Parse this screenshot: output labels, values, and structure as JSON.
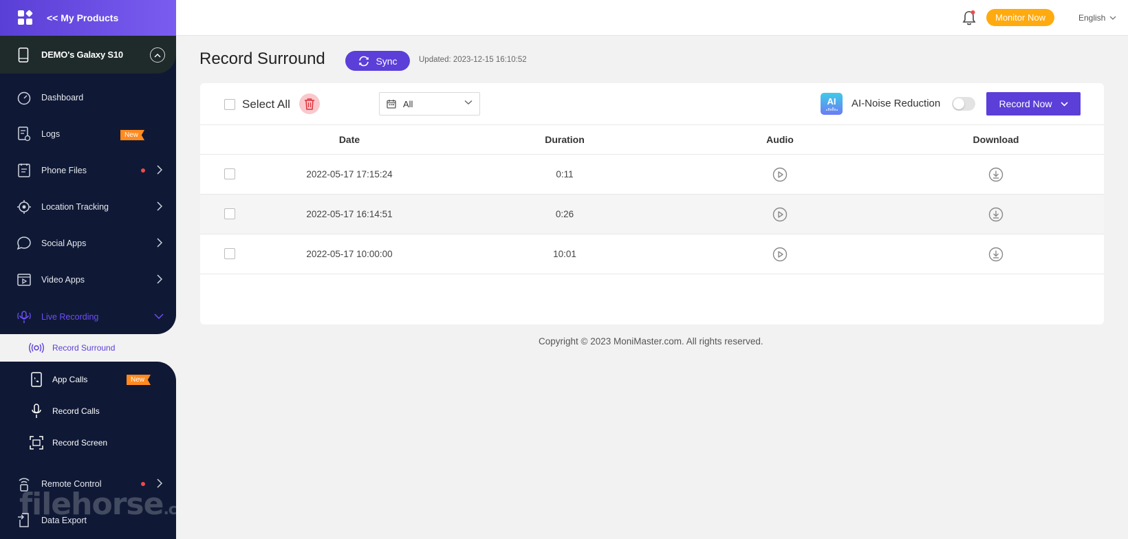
{
  "sidebar": {
    "products_label": "<< My Products",
    "device_name": "DEMO's Galaxy S10",
    "items": [
      {
        "label": "Dashboard"
      },
      {
        "label": "Logs",
        "badge": "New"
      },
      {
        "label": "Phone Files"
      },
      {
        "label": "Location Tracking"
      },
      {
        "label": "Social Apps"
      },
      {
        "label": "Video Apps"
      },
      {
        "label": "Live Recording"
      },
      {
        "label": "Remote Control"
      },
      {
        "label": "Data Export"
      }
    ],
    "sub_items": [
      {
        "label": "Record Surround"
      },
      {
        "label": "App Calls",
        "badge": "New"
      },
      {
        "label": "Record Calls"
      },
      {
        "label": "Record Screen"
      }
    ],
    "watermark": "filehorse",
    "watermark_suffix": ".com"
  },
  "header": {
    "monitor_label": "Monitor Now",
    "language": "English"
  },
  "main": {
    "title": "Record Surround",
    "sync_label": "Sync",
    "updated": "Updated: 2023-12-15 16:10:52",
    "toolbar": {
      "select_all": "Select All",
      "filter_value": "All",
      "ai_logo": "AI",
      "ai_label": "AI-Noise Reduction",
      "record_now": "Record Now"
    },
    "table": {
      "columns": [
        "Date",
        "Duration",
        "Audio",
        "Download"
      ],
      "rows": [
        {
          "date": "2022-05-17 17:15:24",
          "duration": "0:11"
        },
        {
          "date": "2022-05-17 16:14:51",
          "duration": "0:26"
        },
        {
          "date": "2022-05-17 10:00:00",
          "duration": "10:01"
        }
      ]
    },
    "copyright": "Copyright © 2023 MoniMaster.com. All rights reserved."
  },
  "colors": {
    "accent": "#5b3fd8",
    "sidebar_bg": "#0f1935",
    "monitor_btn": "#ffaa0f",
    "badge": "#ff8a1f",
    "alert_dot": "#f2494c"
  },
  "icons": {
    "products": "grid-icon",
    "device": "phone-icon",
    "sync": "refresh-icon",
    "delete": "trash-icon",
    "filter": "calendar-icon",
    "audio": "play-circle-icon",
    "download": "download-circle-icon",
    "notify": "bell-icon"
  }
}
